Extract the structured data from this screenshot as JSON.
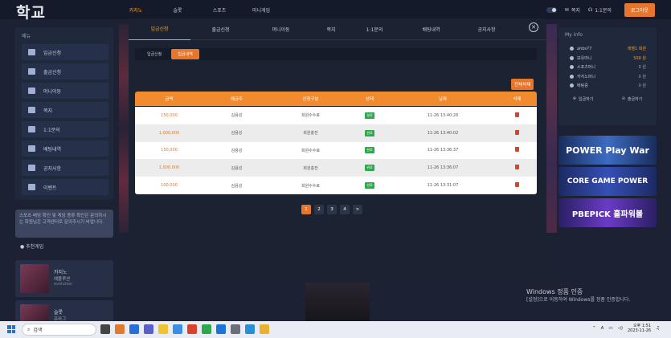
{
  "topbar": {
    "logo": "학교",
    "nav": [
      "카지노",
      "슬롯",
      "스포츠",
      "미니게임"
    ],
    "messages": "쪽지",
    "support": "1:1문의",
    "logout": "로그아웃"
  },
  "left_menu": {
    "title": "메뉴",
    "items": [
      "입금신청",
      "출금신청",
      "머니이동",
      "쪽지",
      "1:1문의",
      "배팅내역",
      "공지사항",
      "이벤트"
    ]
  },
  "notice": "스포츠 배당 확인 및 게임 종류 확인은 문의하시는 회원님은 고객센터로 문의주시기 바랍니다.",
  "recommend": {
    "title": "추천게임",
    "games": [
      {
        "t1": "카지노",
        "t2": "에볼루션",
        "t3": "evolution"
      },
      {
        "t1": "슬롯",
        "t2": "프라그"
      }
    ]
  },
  "my_info": {
    "title": "My info",
    "rows": [
      {
        "label": "ahbs77",
        "value": "레벨1 회원"
      },
      {
        "label": "보유머니",
        "value": "500 원"
      },
      {
        "label": "스포츠머니",
        "value": "0 원"
      },
      {
        "label": "카지노머니",
        "value": "0 원"
      },
      {
        "label": "배팅중",
        "value": "0 원"
      }
    ],
    "deposit": "입금하기",
    "withdraw": "출금하기"
  },
  "banners": [
    "POWER Play War",
    "CORE GAME POWER",
    "PBEPICK 홀파워볼"
  ],
  "modal": {
    "tabs": [
      "입금신청",
      "출금신청",
      "머니이동",
      "쪽지",
      "1:1문의",
      "배팅내역",
      "공지사항"
    ],
    "active_tab": "입금신청",
    "subtabs": [
      "입금신청",
      "입금내역"
    ],
    "delete_all": "전체삭제",
    "columns": [
      "금액",
      "예금주",
      "신청구분",
      "상태",
      "날짜",
      "삭제"
    ],
    "rows": [
      {
        "amount": "150,000",
        "holder": "김용성",
        "type": "회원수수료",
        "status": "완료",
        "date": "11-26 13:40:26"
      },
      {
        "amount": "1,000,000",
        "holder": "김용성",
        "type": "회원충전",
        "status": "완료",
        "date": "11-26 13:40:02"
      },
      {
        "amount": "150,000",
        "holder": "김용성",
        "type": "회원수수료",
        "status": "완료",
        "date": "11-26 13:36:37"
      },
      {
        "amount": "1,000,000",
        "holder": "김용성",
        "type": "회원충전",
        "status": "완료",
        "date": "11-26 13:36:07"
      },
      {
        "amount": "100,000",
        "holder": "김용성",
        "type": "회원수수료",
        "status": "완료",
        "date": "11-26 13:31:07"
      }
    ],
    "pages": [
      "1",
      "2",
      "3",
      "4",
      ">"
    ]
  },
  "windows": {
    "activate_title": "Windows 정품 인증",
    "activate_sub": "[설정]으로 이동하여 Windows를 정품 인증합니다.",
    "search": "검색",
    "time": "오후 1:51",
    "date": "2023-11-26"
  },
  "colors": {
    "accent": "#e8762a",
    "header": "#f28a2e",
    "status": "#2ea84d"
  }
}
